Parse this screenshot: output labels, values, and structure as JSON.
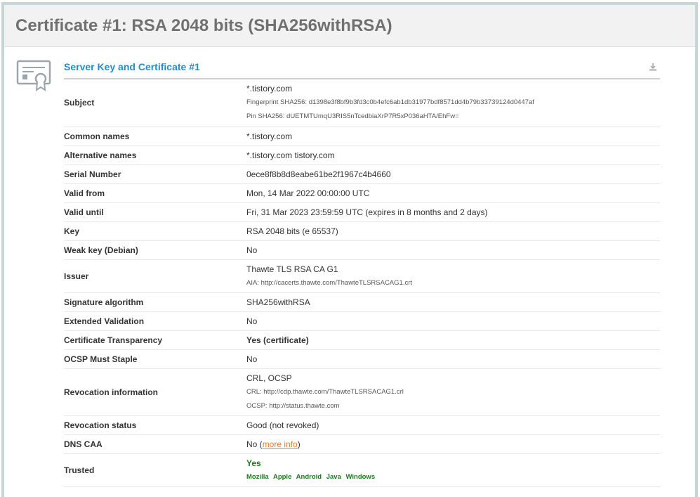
{
  "page_title": "Certificate #1: RSA 2048 bits (SHA256withRSA)",
  "section": {
    "title": "Server Key and Certificate #1",
    "icon": "certificate-icon",
    "download_icon": "download-icon"
  },
  "rows": {
    "subject": {
      "label": "Subject",
      "value": "*.tistory.com",
      "fingerprint": "Fingerprint SHA256: d1398e3f8bf9b3fd3c0b4efc6ab1db31977bdf8571dd4b79b33739124d0447af",
      "pin": "Pin SHA256: dUETMTUmqU3RIS5nTcedbiaXrP7R5xP036aHTA/EhFw="
    },
    "common_names": {
      "label": "Common names",
      "value": "*.tistory.com"
    },
    "alt_names": {
      "label": "Alternative names",
      "value": "*.tistory.com tistory.com"
    },
    "serial": {
      "label": "Serial Number",
      "value": "0ece8f8b8d8eabe61be2f1967c4b4660"
    },
    "valid_from": {
      "label": "Valid from",
      "value": "Mon, 14 Mar 2022 00:00:00 UTC"
    },
    "valid_until": {
      "label": "Valid until",
      "value": "Fri, 31 Mar 2023 23:59:59 UTC (expires in 8 months and 2 days)"
    },
    "key": {
      "label": "Key",
      "value": "RSA 2048 bits (e 65537)"
    },
    "weak_key": {
      "label": "Weak key (Debian)",
      "value": "No"
    },
    "issuer": {
      "label": "Issuer",
      "value": "Thawte TLS RSA CA G1",
      "aia": "AIA: http://cacerts.thawte.com/ThawteTLSRSACAG1.crt"
    },
    "sig_alg": {
      "label": "Signature algorithm",
      "value": "SHA256withRSA"
    },
    "ev": {
      "label": "Extended Validation",
      "value": "No"
    },
    "ct": {
      "label": "Certificate Transparency",
      "value": "Yes (certificate)"
    },
    "ocsp_staple": {
      "label": "OCSP Must Staple",
      "value": "No"
    },
    "revocation_info": {
      "label": "Revocation information",
      "value": "CRL, OCSP",
      "crl": "CRL: http://cdp.thawte.com/ThawteTLSRSACAG1.crl",
      "ocsp": "OCSP: http://status.thawte.com"
    },
    "revocation_status": {
      "label": "Revocation status",
      "value": "Good (not revoked)"
    },
    "dns_caa": {
      "label": "DNS CAA",
      "value": "No",
      "open_paren": " (",
      "link": "more info",
      "close_paren": ")"
    },
    "trusted": {
      "label": "Trusted",
      "value": "Yes",
      "platforms": [
        "Mozilla",
        "Apple",
        "Android",
        "Java",
        "Windows"
      ]
    }
  },
  "colors": {
    "accent_blue": "#1f8fcf",
    "ok_green": "#1a7a1a",
    "warn_orange": "#e87c2a",
    "frame_border": "#c5d6d6"
  }
}
